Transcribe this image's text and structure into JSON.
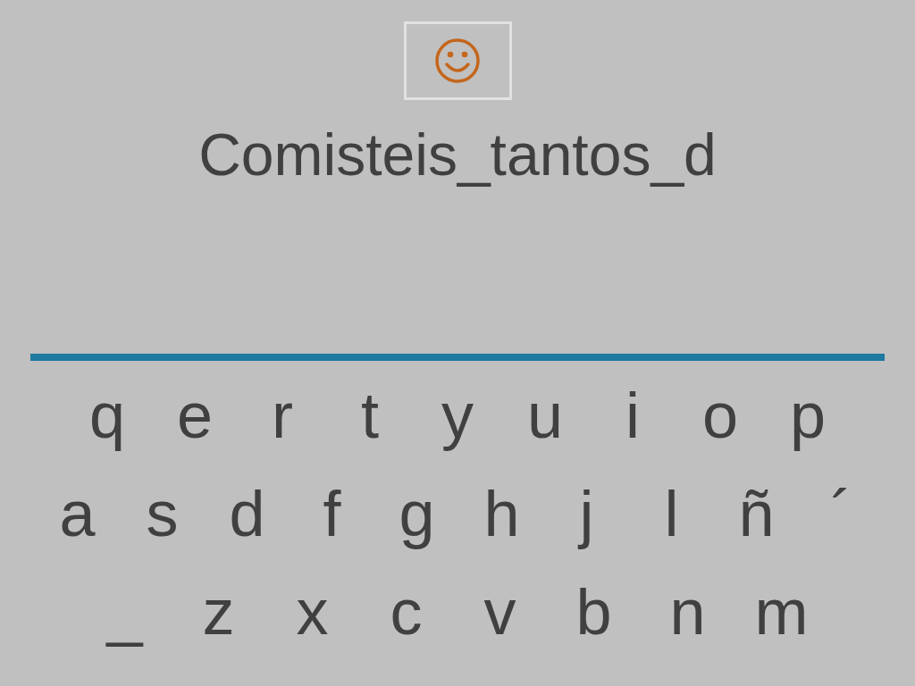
{
  "answer": "Comisteis_tantos_d",
  "keyboard": {
    "rows": [
      [
        "q",
        "e",
        "r",
        "t",
        "y",
        "u",
        "i",
        "o",
        "p"
      ],
      [
        "a",
        "s",
        "d",
        "f",
        "g",
        "h",
        "j",
        "l",
        "ñ",
        "´"
      ],
      [
        "_",
        "z",
        "x",
        "c",
        "v",
        "b",
        "n",
        "m"
      ]
    ]
  }
}
